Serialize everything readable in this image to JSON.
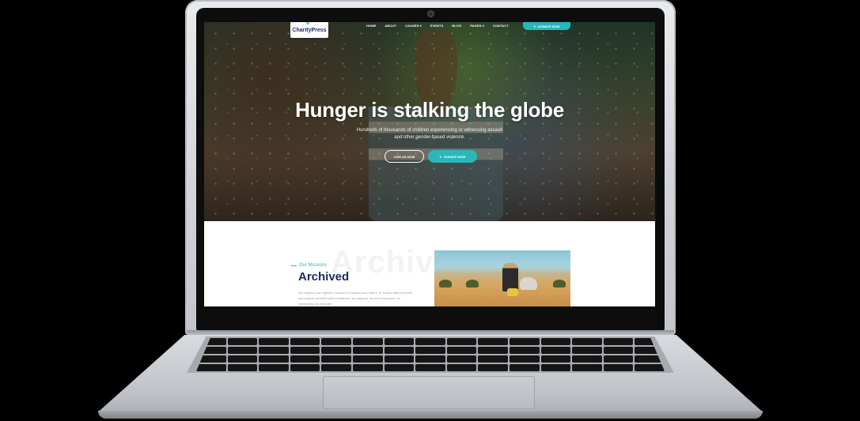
{
  "site": {
    "logo_text": "CharityPress",
    "nav": [
      "HOME",
      "ABOUT",
      "CAUSES ▾",
      "EVENTS",
      "BLOG",
      "PAGES ▾",
      "CONTACT"
    ],
    "donate_top_label": "DONATE NOW"
  },
  "hero": {
    "title": "Hunger is stalking the globe",
    "subtitle": "Hundreds of thousands of children experiencing or witnessing assault and other gender-based violence.",
    "join_label": "JOIN US NOW",
    "donate_label": "DONATE NOW"
  },
  "mission": {
    "background_word": "Archive",
    "eyebrow": "Our Missions",
    "title": "Archived",
    "body": "We register and regulate charities in England and Wales, to ensure that the public can support charities with confidence. As registrar, we are responsible for maintaining an accurate"
  },
  "colors": {
    "accent": "#28b8ba",
    "heading": "#172a5a",
    "laptop": "#cfd3d8"
  },
  "icons": {
    "heart": "heart-icon"
  }
}
